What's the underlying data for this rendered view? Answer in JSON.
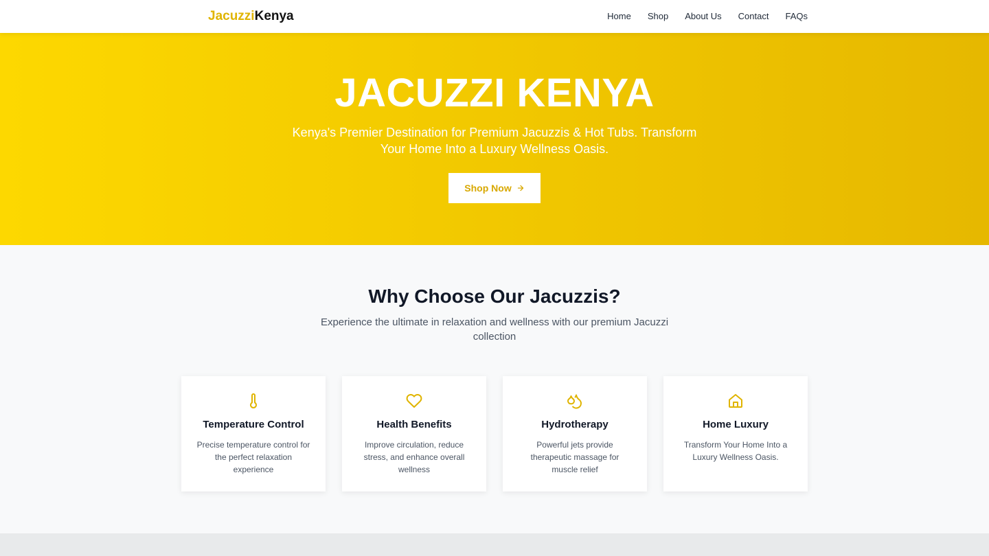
{
  "brand": {
    "part1": "Jacuzzi",
    "part2": "Kenya",
    "accent": "#e0b400"
  },
  "nav": [
    {
      "label": "Home"
    },
    {
      "label": "Shop"
    },
    {
      "label": "About Us"
    },
    {
      "label": "Contact"
    },
    {
      "label": "FAQs"
    }
  ],
  "hero": {
    "title": "JACUZZI KENYA",
    "subtitle": "Kenya's Premier Destination for Premium Jacuzzis & Hot Tubs. Transform Your Home Into a Luxury Wellness Oasis.",
    "cta_label": "Shop Now",
    "cta_icon": "arrow-right-icon",
    "gradient": [
      "#fdd800",
      "#e6b800"
    ]
  },
  "features": {
    "title": "Why Choose Our Jacuzzis?",
    "subtitle": "Experience the ultimate in relaxation and wellness with our premium Jacuzzi collection",
    "cards": [
      {
        "icon": "thermometer-icon",
        "title": "Temperature Control",
        "desc": "Precise temperature control for the perfect relaxation experience"
      },
      {
        "icon": "heart-icon",
        "title": "Health Benefits",
        "desc": "Improve circulation, reduce stress, and enhance overall wellness"
      },
      {
        "icon": "droplets-icon",
        "title": "Hydrotherapy",
        "desc": "Powerful jets provide therapeutic massage for muscle relief"
      },
      {
        "icon": "home-icon",
        "title": "Home Luxury",
        "desc": "Transform Your Home Into a Luxury Wellness Oasis."
      }
    ]
  }
}
